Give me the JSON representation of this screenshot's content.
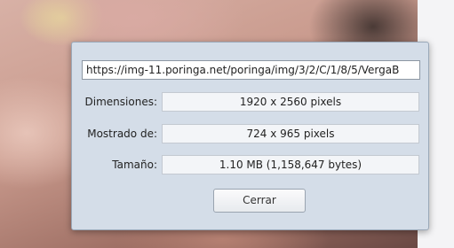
{
  "dialog": {
    "url": "https://img-11.poringa.net/poringa/img/3/2/C/1/8/5/VergaB",
    "rows": [
      {
        "label": "Dimensiones:",
        "value": "1920 x 2560 pixels"
      },
      {
        "label": "Mostrado de:",
        "value": "724 x 965 pixels"
      },
      {
        "label": "Tamaño:",
        "value": "1.10 MB (1,158,647 bytes)"
      }
    ],
    "close_label": "Cerrar"
  }
}
